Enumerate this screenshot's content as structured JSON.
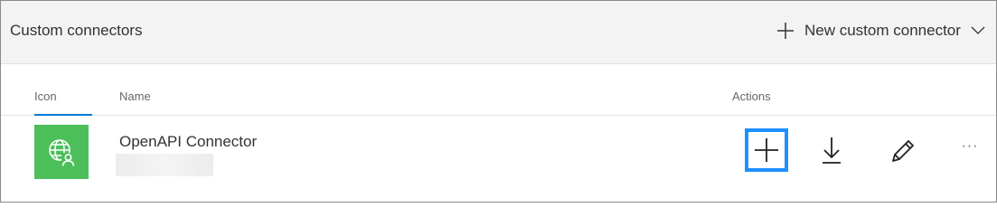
{
  "header": {
    "title": "Custom connectors",
    "new_button_label": "New custom connector"
  },
  "columns": {
    "icon": "Icon",
    "name": "Name",
    "actions": "Actions"
  },
  "rows": [
    {
      "name": "OpenAPI Connector",
      "icon": "globe-person-icon",
      "icon_bg": "#4cbf5b",
      "actions": [
        "add-icon",
        "download-icon",
        "edit-icon",
        "more-icon"
      ],
      "more_label": "···"
    }
  ],
  "colors": {
    "accent": "#0078d4",
    "focus_ring": "#1e90ff",
    "header_bg": "#f3f3f3"
  }
}
